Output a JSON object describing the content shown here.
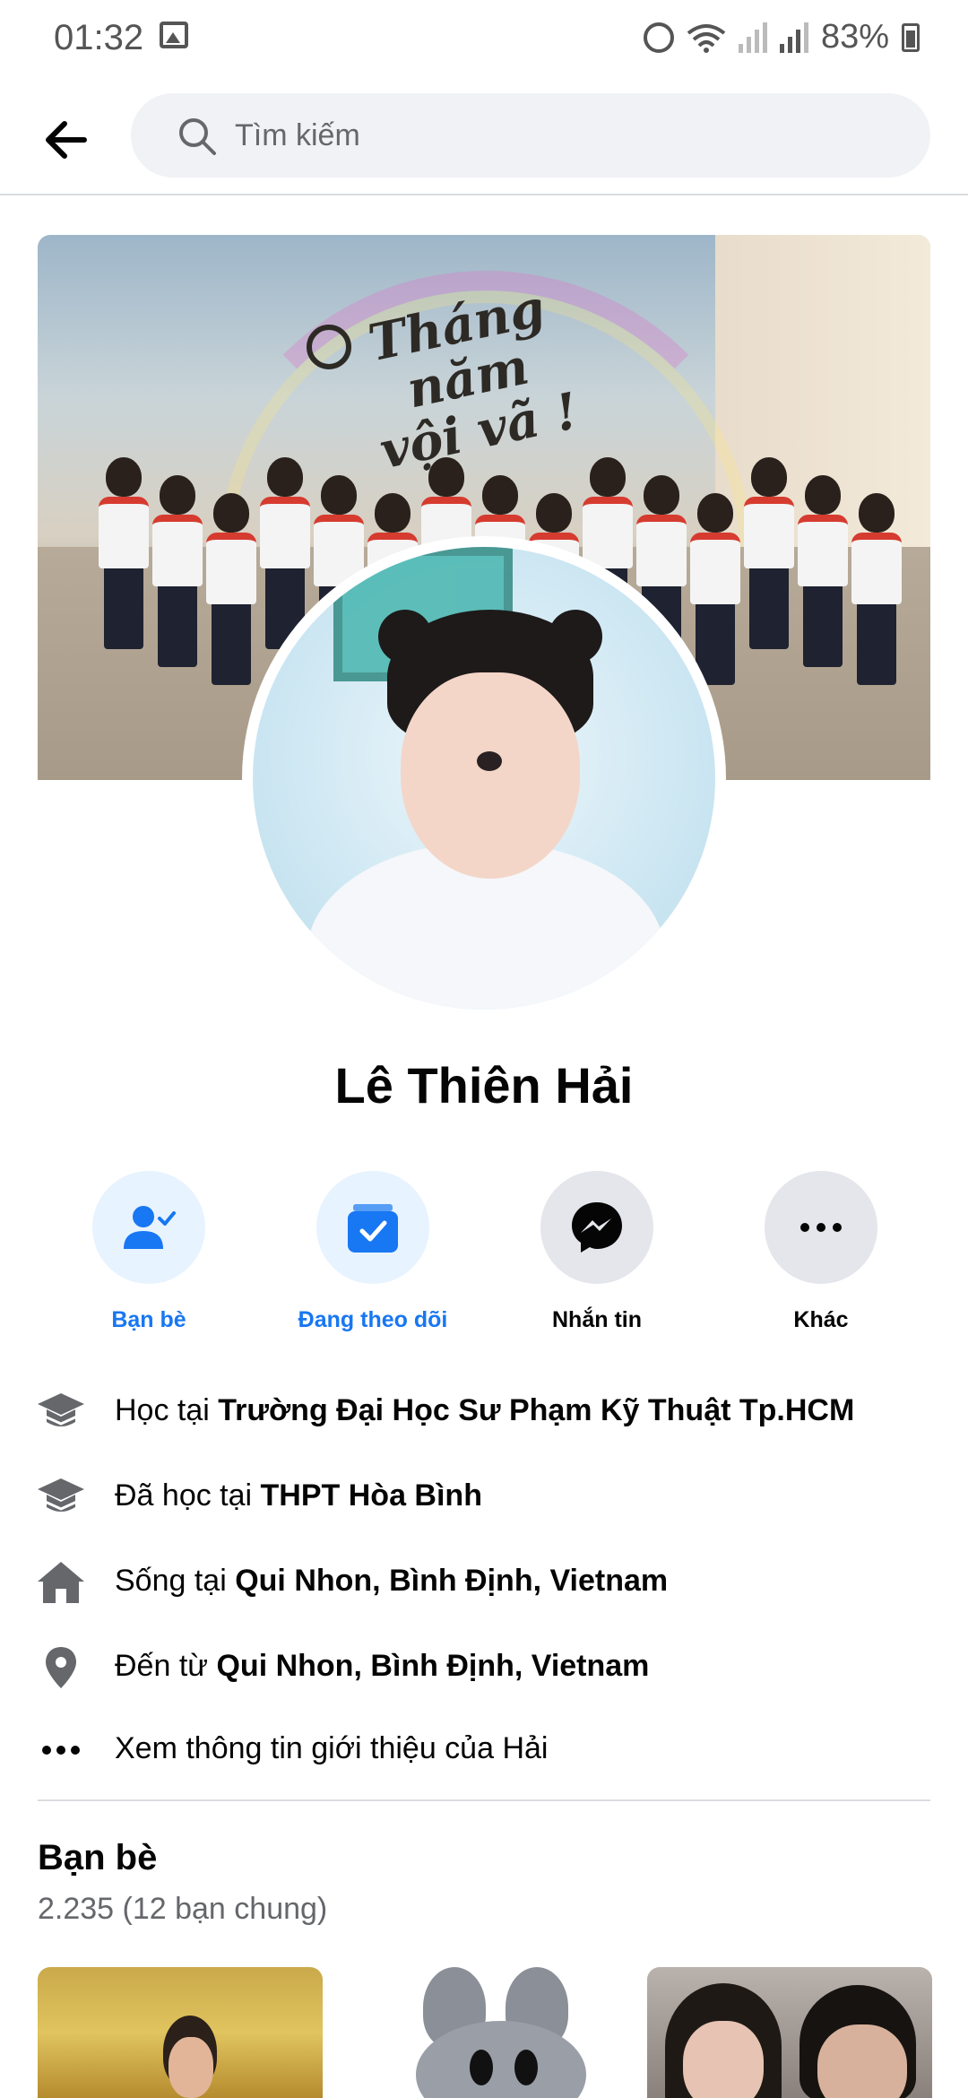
{
  "status_bar": {
    "time": "01:32",
    "battery": "83%"
  },
  "header": {
    "search_placeholder": "Tìm kiếm"
  },
  "cover": {
    "caption_lines": [
      "Tháng",
      "năm",
      "vội vã !"
    ]
  },
  "profile": {
    "name": "Lê Thiên Hải"
  },
  "actions": [
    {
      "label": "Bạn bè",
      "icon": "friends-check-icon",
      "color": "#1877f2"
    },
    {
      "label": "Đang theo dõi",
      "icon": "following-check-icon",
      "color": "#1877f2"
    },
    {
      "label": "Nhắn tin",
      "icon": "messenger-icon",
      "color": "#050505"
    },
    {
      "label": "Khác",
      "icon": "more-icon",
      "color": "#050505"
    }
  ],
  "info": [
    {
      "icon": "school-icon",
      "prefix": "Học tại ",
      "value": "Trường Đại Học Sư Phạm Kỹ Thuật Tp.HCM"
    },
    {
      "icon": "school-icon",
      "prefix": "Đã học tại ",
      "value": "THPT Hòa Bình"
    },
    {
      "icon": "home-icon",
      "prefix": "Sống tại ",
      "value": "Qui Nhon, Bình Định, Vietnam"
    },
    {
      "icon": "location-pin-icon",
      "prefix": "Đến từ ",
      "value": "Qui Nhon, Bình Định, Vietnam"
    },
    {
      "icon": "more-dots-icon",
      "prefix": "Xem thông tin giới thiệu của Hải",
      "value": ""
    }
  ],
  "friends": {
    "title": "Bạn bè",
    "count_text": "2.235 (12 bạn chung)"
  },
  "colors": {
    "accent": "#1877f2",
    "accent_bg": "#e7f3ff",
    "gray_bg": "#e4e6eb",
    "secondary_text": "#65676b"
  }
}
